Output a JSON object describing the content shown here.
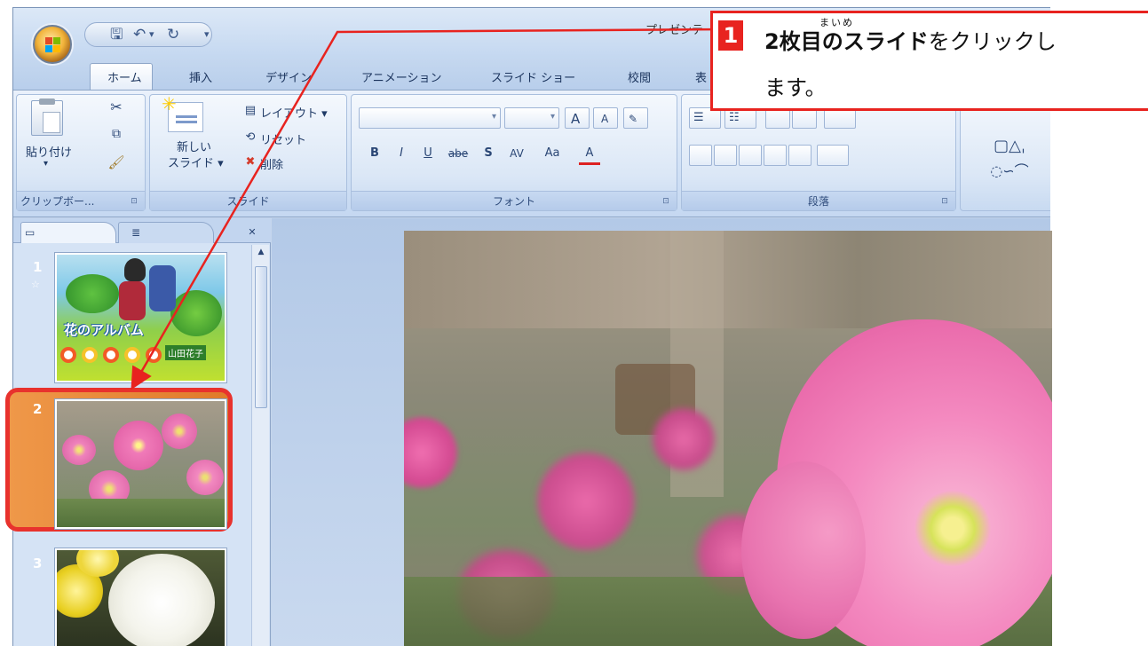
{
  "window": {
    "title": "プレゼンテ"
  },
  "ribbon_tabs": [
    "ホーム",
    "挿入",
    "デザイン",
    "アニメーション",
    "スライド ショー",
    "校閲",
    "表"
  ],
  "clipboard": {
    "paste_label": "貼り付け",
    "group_label": "クリップボー...",
    "launcher": "⊡"
  },
  "slides_group": {
    "new_slide_line1": "新しい",
    "new_slide_line2": "スライド ▾",
    "layout": "レイアウト ▾",
    "reset": "リセット",
    "delete": "削除",
    "group_label": "スライド"
  },
  "font_group": {
    "grow": "A",
    "shrink": "A",
    "bold": "B",
    "italic": "I",
    "underline": "U",
    "strike": "abe",
    "shadow": "S",
    "spacing": "AV",
    "case": "Aa",
    "color": "A",
    "group_label": "フォント"
  },
  "paragraph_group": {
    "group_label": "段落"
  },
  "slide_panel": {
    "slides": [
      {
        "number": "1",
        "title_text": "花のアルバム",
        "subtitle_text": "山田花子",
        "star": "☆"
      },
      {
        "number": "2"
      },
      {
        "number": "3"
      }
    ]
  },
  "callout": {
    "number": "1",
    "ruby": "まいめ",
    "bold_part": "2枚目のスライド",
    "normal_part": "をクリックし",
    "line2": "ます。"
  },
  "colors": {
    "accent": "#e8231f",
    "selection": "#e07a2a",
    "ribbon": "#d4e3f6"
  }
}
